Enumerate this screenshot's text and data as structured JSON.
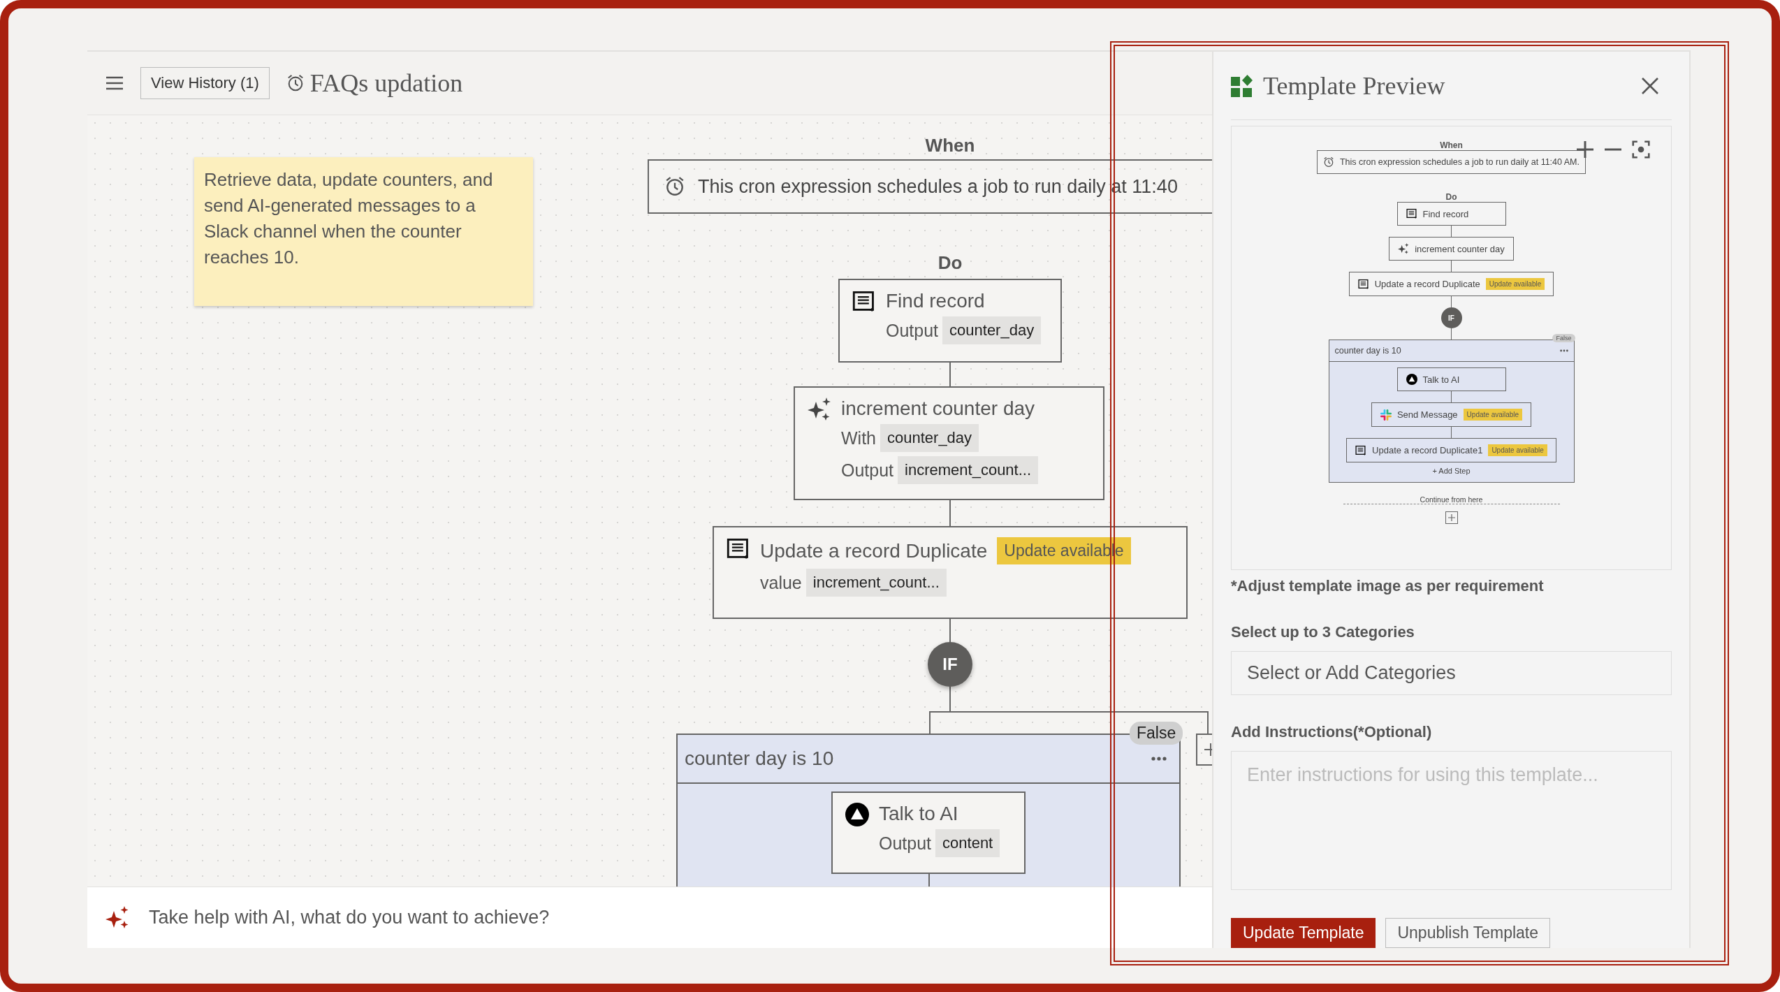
{
  "header": {
    "history_button": "View History (1)",
    "title": "FAQs updation"
  },
  "note": {
    "text": "Retrieve data, update counters, and send AI-generated messages to a Slack channel when the counter reaches 10."
  },
  "canvas": {
    "when_label": "When",
    "trigger": "This cron expression schedules a job to run daily at 11:40",
    "do_label": "Do",
    "steps": [
      {
        "kind": "record",
        "title": "Find record",
        "fields": [
          {
            "label": "Output",
            "value": "counter_day"
          }
        ]
      },
      {
        "kind": "ai",
        "title": "increment counter day",
        "fields": [
          {
            "label": "With",
            "value": "counter_day"
          },
          {
            "label": "Output",
            "value": "increment_count..."
          }
        ]
      },
      {
        "kind": "record",
        "title": "Update a record Duplicate",
        "badge": "Update available",
        "fields": [
          {
            "label": "value",
            "value": "increment_count..."
          }
        ]
      }
    ],
    "if_label": "IF",
    "condition": {
      "title": "counter day is 10",
      "branch": "False",
      "steps": [
        {
          "kind": "talk",
          "title": "Talk to AI",
          "fields": [
            {
              "label": "Output",
              "value": "content"
            }
          ]
        }
      ]
    }
  },
  "ai_bar": {
    "placeholder": "Take help with AI, what do you want to achieve?"
  },
  "panel": {
    "title": "Template Preview",
    "preview": {
      "when_label": "When",
      "trigger": "This cron expression schedules a job to run daily at 11:40 AM.",
      "do_label": "Do",
      "steps": [
        {
          "kind": "record",
          "title": "Find record"
        },
        {
          "kind": "ai",
          "title": "increment counter day"
        },
        {
          "kind": "record",
          "title": "Update a record Duplicate",
          "badge": "Update available"
        }
      ],
      "if_label": "IF",
      "condition": {
        "title": "counter day is 10",
        "branch": "False",
        "add_step": "+ Add Step",
        "steps": [
          {
            "kind": "talk",
            "title": "Talk to AI"
          },
          {
            "kind": "slack",
            "title": "Send Message",
            "badge": "Update available"
          },
          {
            "kind": "record",
            "title": "Update a record Duplicate1",
            "badge": "Update available"
          }
        ]
      },
      "continue_label": "Continue from here"
    },
    "image_note": "*Adjust template image as per requirement",
    "categories_label": "Select up to 3 Categories",
    "categories_placeholder": "Select or Add Categories",
    "instructions_label": "Add Instructions(*Optional)",
    "instructions_placeholder": "Enter instructions for using this template...",
    "buttons": [
      {
        "label": "Update Template",
        "kind": "primary"
      },
      {
        "label": "Unpublish Template",
        "kind": "secondary"
      }
    ]
  }
}
